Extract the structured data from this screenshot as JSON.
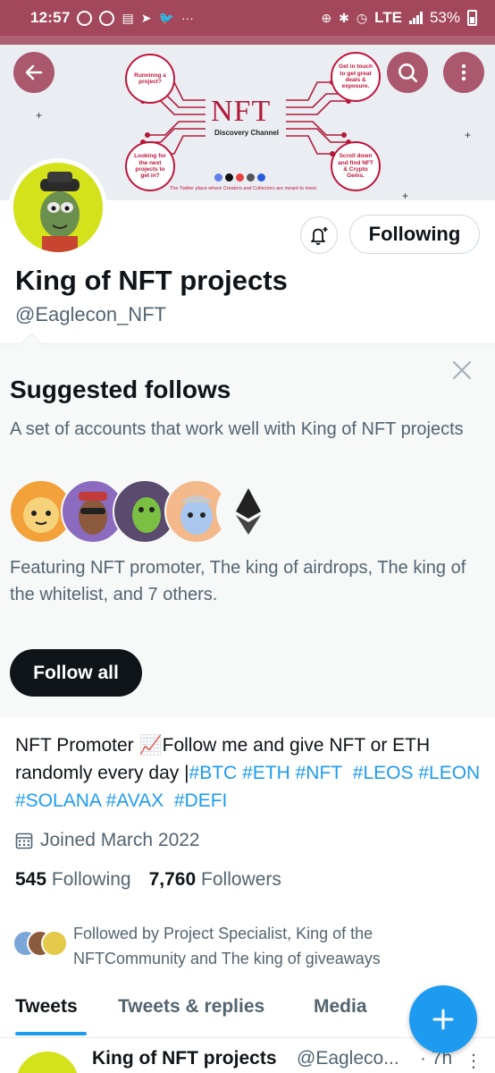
{
  "status_bar": {
    "time": "12:57",
    "network": "LTE",
    "battery": "53%"
  },
  "banner": {
    "title": "NFT",
    "subtitle": "Discovery Channel",
    "bubbles": [
      "Runninng a project?",
      "Get in touch to get great deals & exposure.",
      "Looking for the next projects to get in?",
      "Scroll down and find NFT & Crypto Gems."
    ],
    "caption": "The Twitter place where Creators and Collectors are meant to meet."
  },
  "header": {
    "following_button": "Following"
  },
  "profile": {
    "name": "King of NFT projects",
    "handle": "@Eaglecon_NFT"
  },
  "suggested": {
    "title": "Suggested follows",
    "description": "A set of accounts that work well with King of NFT projects",
    "featuring": "Featuring NFT promoter, The king of airdrops, The king of the whitelist, and 7 others.",
    "follow_all": "Follow all"
  },
  "bio": {
    "text_1": "NFT Promoter ",
    "emoji": "📈",
    "text_2": "Follow me and give NFT or ETH randomly every day |",
    "tags": [
      "#BTC",
      "#ETH",
      "#NFT",
      "#LEOS",
      "#LEON",
      "#SOLANA",
      "#AVAX",
      "#DEFI"
    ]
  },
  "joined": "Joined March 2022",
  "stats": {
    "following_count": "545",
    "following_label": "Following",
    "followers_count": "7,760",
    "followers_label": "Followers"
  },
  "followed_by": "Followed by Project Specialist, King of the NFTCommunity and The king of giveaways",
  "tabs": [
    "Tweets",
    "Tweets & replies",
    "Media"
  ],
  "tweet": {
    "name": "King of NFT projects",
    "handle": "@Eagleco...",
    "time": "· 7h"
  },
  "colors": {
    "accent": "#1d9bf0",
    "status_bar": "#a3475c",
    "secondary_text": "#536471"
  }
}
